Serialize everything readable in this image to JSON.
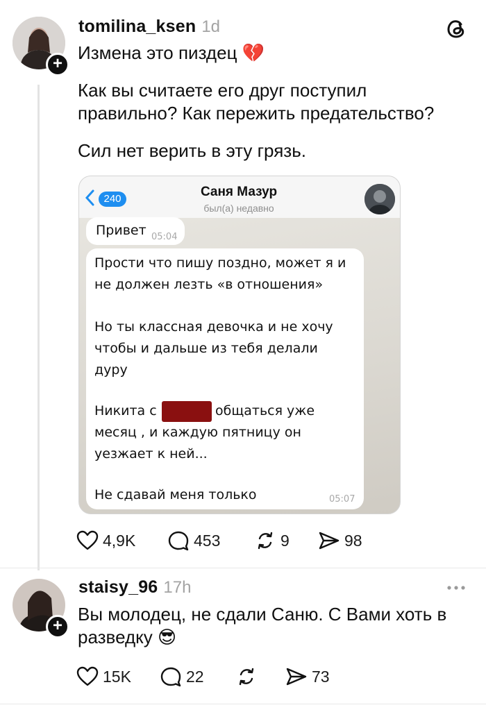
{
  "post": {
    "username": "tomilina_ksen",
    "time": "1d",
    "title_line": "Измена это пиздец",
    "title_emoji": "💔",
    "paragraph1_line1": "Как вы считаете его друг поступил",
    "paragraph1_line2": "правильно? Как пережить предательство?",
    "paragraph2": "Сил нет верить в эту грязь.",
    "actions": {
      "likes": "4,9K",
      "comments": "453",
      "reposts": "9",
      "shares": "98"
    }
  },
  "chat": {
    "back_count": "240",
    "contact_name": "Саня Мазур",
    "contact_status": "был(а) недавно",
    "greeting": "Привет",
    "greeting_time": "05:04",
    "lines": [
      "Прости что пишу поздно, может я и",
      "не должен лезть «в отношения»",
      "Но ты классная девочка и не хочу",
      "чтобы и дальше из тебя делали",
      "дуру",
      "Никита с",
      "общаться уже",
      "месяц , и каждую пятницу он",
      "уезжает к ней...",
      "Не сдавай меня только"
    ],
    "message_time": "05:07"
  },
  "reply": {
    "username": "staisy_96",
    "time": "17h",
    "text_line1": "Вы молодец, не сдали Саню. С Вами хоть в",
    "text_line2": "разведку",
    "text_emoji": "😎",
    "actions": {
      "likes": "15K",
      "comments": "22",
      "shares": "73"
    }
  },
  "icons": {
    "app_logo": "threads-logo-icon",
    "more": "more-dots-icon"
  }
}
